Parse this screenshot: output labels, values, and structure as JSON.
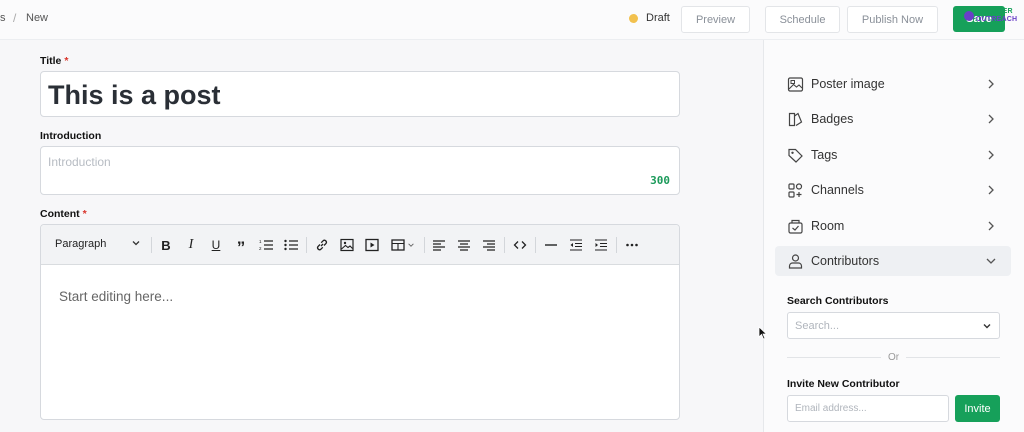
{
  "breadcrumb": {
    "prev": "s",
    "sep": "/",
    "current": "New"
  },
  "header": {
    "status": "Draft",
    "status_color": "#f2c14e",
    "preview_label": "Preview",
    "schedule_label": "Schedule",
    "publish_label": "Publish Now",
    "save_label": "Save"
  },
  "watermark": {
    "line1": "BLOGGER",
    "line2": "OUTREACH"
  },
  "form": {
    "title_label": "Title",
    "title_value": "This is a post",
    "intro_label": "Introduction",
    "intro_placeholder": "Introduction",
    "intro_counter": "300",
    "content_label": "Content",
    "required_mark": "*",
    "paragraph_select": "Paragraph",
    "editor_placeholder": "Start editing here..."
  },
  "toolbar_icons": [
    "bold-icon",
    "italic-icon",
    "underline-icon",
    "quote-icon",
    "ordered-list-icon",
    "bullet-list-icon",
    "link-icon",
    "image-icon",
    "video-icon",
    "table-icon",
    "align-left-icon",
    "align-center-icon",
    "align-right-icon",
    "code-icon",
    "horizontal-rule-icon",
    "outdent-icon",
    "indent-icon",
    "more-icon"
  ],
  "sidebar": {
    "items": [
      {
        "label": "Poster image",
        "icon": "image-icon"
      },
      {
        "label": "Badges",
        "icon": "badge-icon"
      },
      {
        "label": "Tags",
        "icon": "tag-icon"
      },
      {
        "label": "Channels",
        "icon": "channels-icon"
      },
      {
        "label": "Room",
        "icon": "room-icon"
      },
      {
        "label": "Contributors",
        "icon": "users-icon",
        "expanded": true
      }
    ],
    "search_label": "Search Contributors",
    "search_placeholder": "Search...",
    "or_text": "Or",
    "invite_label": "Invite New Contributor",
    "email_placeholder": "Email address...",
    "invite_button": "Invite"
  },
  "colors": {
    "accent_green": "#16a05a",
    "counter_green": "#1b9a5a",
    "required_red": "#d9342b"
  }
}
